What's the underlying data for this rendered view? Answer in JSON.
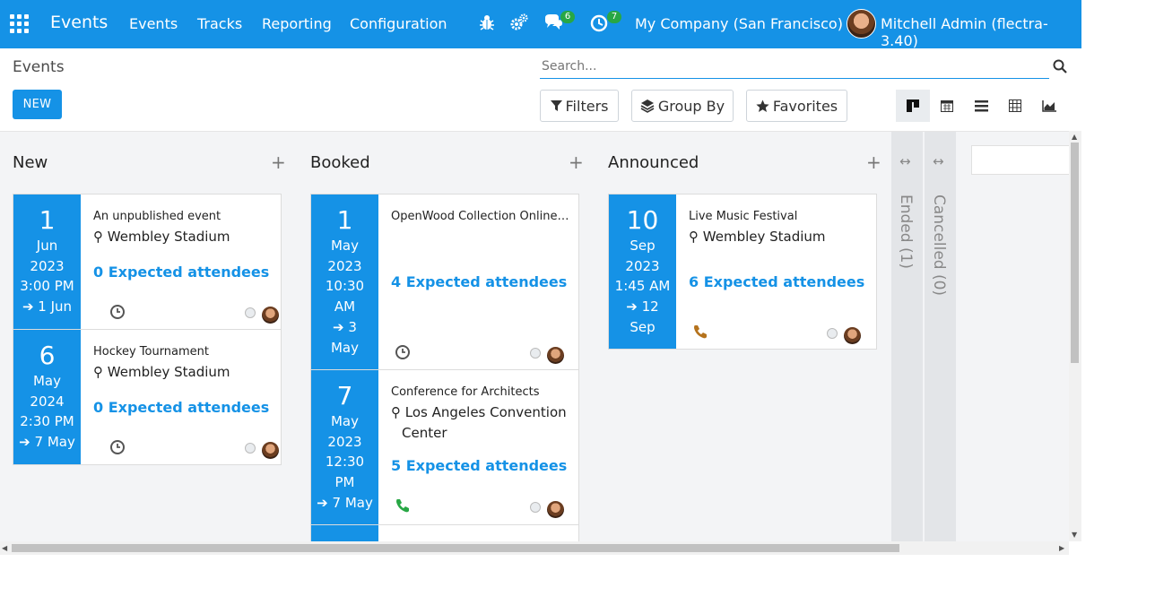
{
  "navbar": {
    "app_name": "Events",
    "menus": [
      "Events",
      "Tracks",
      "Reporting",
      "Configuration"
    ],
    "messages_count": "6",
    "activities_count": "7",
    "company": "My Company (San Francisco)",
    "user": "Mitchell Admin (flectra-3.40)"
  },
  "control": {
    "breadcrumb": "Events",
    "new_label": "NEW",
    "search_placeholder": "Search...",
    "filters_label": "Filters",
    "group_by_label": "Group By",
    "favorites_label": "Favorites"
  },
  "columns": [
    {
      "title": "New",
      "cards": [
        {
          "day": "1",
          "month": "Jun",
          "year": "2023",
          "time": "3:00 PM",
          "end": "1 Jun",
          "name": "An unpublished event",
          "location": "Wembley Stadium",
          "attendees": "0 Expected attendees",
          "activity": "clock"
        },
        {
          "day": "6",
          "month": "May",
          "year": "2024",
          "time": "2:30 PM",
          "end": "7 May",
          "name": "Hockey Tournament",
          "location": "Wembley Stadium",
          "attendees": "0 Expected attendees",
          "activity": "clock"
        }
      ]
    },
    {
      "title": "Booked",
      "cards": [
        {
          "day": "1",
          "month": "May",
          "year": "2023",
          "time_1": "10:30",
          "time_2": "AM",
          "end_1": "3",
          "end_2": "May",
          "name": "OpenWood Collection Online R...",
          "attendees": "4 Expected attendees",
          "activity": "clock"
        },
        {
          "day": "7",
          "month": "May",
          "year": "2023",
          "time_1": "12:30",
          "time_2": "PM",
          "end": "7 May",
          "name": "Conference for Architects",
          "location_1": "Los Angeles Convention",
          "location_2": "Center",
          "attendees": "5 Expected attendees",
          "activity": "phone"
        }
      ]
    },
    {
      "title": "Announced",
      "cards": [
        {
          "day": "10",
          "month": "Sep",
          "year": "2023",
          "time": "1:45 AM",
          "end_1": "12",
          "end_2": "Sep",
          "name": "Live Music Festival",
          "location": "Wembley Stadium",
          "attendees": "6 Expected attendees",
          "activity": "phone-warning"
        }
      ]
    }
  ],
  "folded_columns": [
    "Ended (1)",
    "Cancelled (0)"
  ],
  "colors": {
    "primary": "#1592e6",
    "activity_ok": "#28a745",
    "activity_warning": "#b5731d"
  }
}
